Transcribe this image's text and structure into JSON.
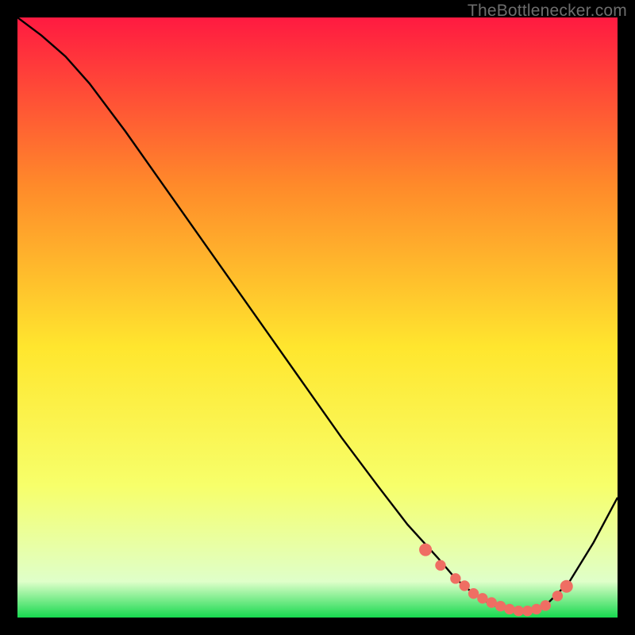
{
  "watermark": "TheBottlenecker.com",
  "colors": {
    "background": "#000000",
    "line": "#000000",
    "marker_fill": "#ef6e63",
    "marker_stroke": "#ef6e63",
    "gradient_top": "#ff1a41",
    "gradient_mid_upper": "#ff8a2a",
    "gradient_mid": "#ffe62e",
    "gradient_mid_lower": "#f7ff6a",
    "gradient_pale": "#dfffc9",
    "gradient_green": "#17d94f"
  },
  "chart_data": {
    "type": "line",
    "title": "",
    "xlabel": "",
    "ylabel": "",
    "xlim": [
      0,
      100
    ],
    "ylim": [
      0,
      100
    ],
    "note": "Values read from pixel positions; X axis normalized 0-100 left→right, Y axis normalized 0-100 bottom→top.",
    "series": [
      {
        "name": "curve",
        "x": [
          0,
          4,
          8,
          12,
          18,
          24,
          30,
          36,
          42,
          48,
          54,
          60,
          65,
          70,
          73,
          76,
          78,
          80,
          82,
          84,
          86,
          88,
          92,
          96,
          100
        ],
        "y": [
          100,
          97,
          93.5,
          89,
          81,
          72.5,
          64,
          55.5,
          47,
          38.5,
          30,
          22,
          15.5,
          10,
          6.5,
          4,
          2.7,
          1.8,
          1.3,
          1.1,
          1.2,
          2,
          6,
          12.5,
          20
        ]
      }
    ],
    "markers": {
      "name": "highlight-dots",
      "x": [
        68,
        70.5,
        73,
        74.5,
        76,
        77.5,
        79,
        80.5,
        82,
        83.5,
        85,
        86.5,
        88,
        90,
        91.5
      ],
      "y": [
        11.3,
        8.7,
        6.5,
        5.3,
        4.0,
        3.2,
        2.5,
        1.9,
        1.4,
        1.1,
        1.1,
        1.4,
        2.0,
        3.6,
        5.2
      ]
    },
    "gradient_stops": [
      {
        "offset": 0.0,
        "key": "gradient_top"
      },
      {
        "offset": 0.28,
        "key": "gradient_mid_upper"
      },
      {
        "offset": 0.55,
        "key": "gradient_mid"
      },
      {
        "offset": 0.78,
        "key": "gradient_mid_lower"
      },
      {
        "offset": 0.94,
        "key": "gradient_pale"
      },
      {
        "offset": 1.0,
        "key": "gradient_green"
      }
    ]
  }
}
